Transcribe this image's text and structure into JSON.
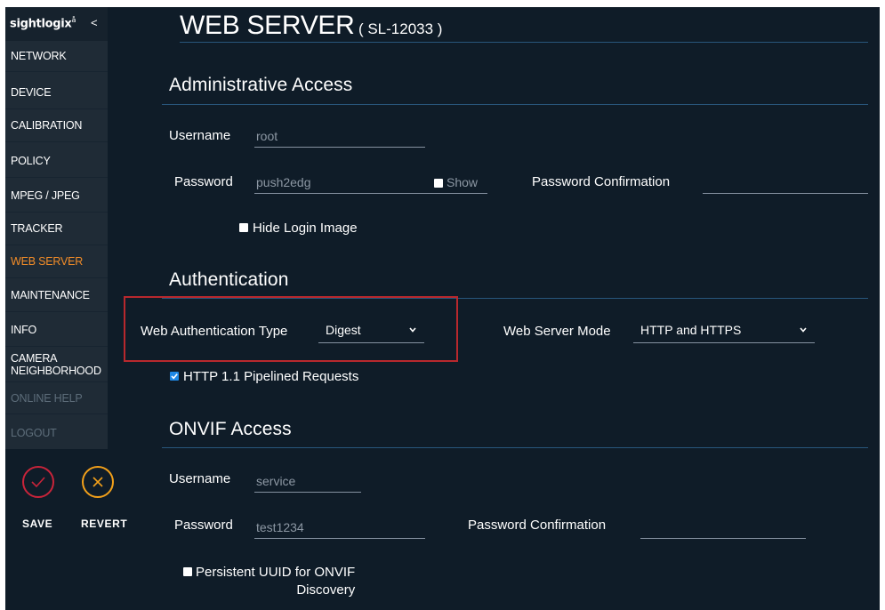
{
  "sidebar": {
    "logo": "sightlogix",
    "logo_mark": "å",
    "collapse": "<",
    "items": [
      {
        "label": "NETWORK"
      },
      {
        "label": "DEVICE"
      },
      {
        "label": "CALIBRATION"
      },
      {
        "label": "POLICY"
      },
      {
        "label": "MPEG / JPEG"
      },
      {
        "label": "TRACKER"
      },
      {
        "label": "WEB SERVER",
        "active": true
      },
      {
        "label": "MAINTENANCE"
      },
      {
        "label": "INFO"
      },
      {
        "label_line1": "CAMERA",
        "label_line2": "NEIGHBORHOOD"
      },
      {
        "label": "ONLINE HELP",
        "disabled": true
      },
      {
        "label": "LOGOUT",
        "disabled": true
      }
    ],
    "save_label": "SAVE",
    "revert_label": "REVERT"
  },
  "header": {
    "title": "WEB SERVER",
    "model": "( SL-12033 )"
  },
  "admin": {
    "section_title": "Administrative Access",
    "username_label": "Username",
    "username_value": "root",
    "password_label": "Password",
    "password_value": "push2edg",
    "show_label": "Show",
    "password_confirm_label": "Password Confirmation",
    "password_confirm_value": "",
    "hide_login_image_label": "Hide Login Image"
  },
  "auth": {
    "section_title": "Authentication",
    "web_auth_type_label": "Web Authentication Type",
    "web_auth_type_value": "Digest",
    "web_server_mode_label": "Web Server Mode",
    "web_server_mode_value": "HTTP and HTTPS",
    "pipelined_label": "HTTP 1.1 Pipelined Requests",
    "pipelined_checked": true
  },
  "onvif": {
    "section_title": "ONVIF Access",
    "username_label": "Username",
    "username_value": "service",
    "password_label": "Password",
    "password_value": "test1234",
    "password_confirm_label": "Password Confirmation",
    "password_confirm_value": "",
    "persistent_uuid_line1": "Persistent UUID for ONVIF",
    "persistent_uuid_line2": "Discovery"
  },
  "colors": {
    "background": "#0f1c28",
    "sidebar": "#1f2b36",
    "active_nav": "#f28c28",
    "section_rule": "#28567c",
    "save_ring": "#c8243a",
    "revert_ring": "#f2a01a",
    "highlight_box": "#b8282d"
  }
}
